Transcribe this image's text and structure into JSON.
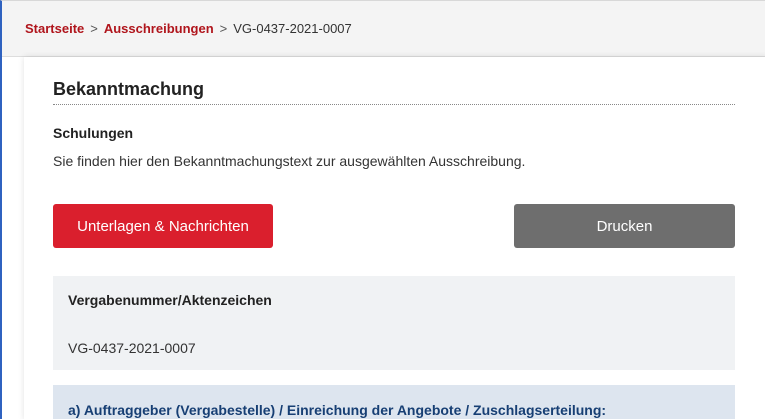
{
  "breadcrumb": {
    "home": "Startseite",
    "separator": ">",
    "tenders": "Ausschreibungen",
    "current": "VG-0437-2021-0007"
  },
  "section": {
    "title": "Bekanntmachung",
    "subheading": "Schulungen",
    "intro": "Sie finden hier den Bekanntmachungstext zur ausgewählten Ausschreibung."
  },
  "buttons": {
    "documents_label": "Unterlagen & Nachrichten",
    "print_label": "Drucken"
  },
  "info": {
    "label": "Vergabenummer/Aktenzeichen",
    "value": "VG-0437-2021-0007"
  },
  "accordion": {
    "title": "a) Auftraggeber (Vergabestelle) / Einreichung der Angebote / Zuschlagserteilung:"
  },
  "colors": {
    "link_red": "#b0151c",
    "primary_button": "#da1f2d",
    "secondary_button": "#6e6e6e",
    "accordion_bg": "#dde5ef",
    "accordion_text": "#173f74"
  }
}
